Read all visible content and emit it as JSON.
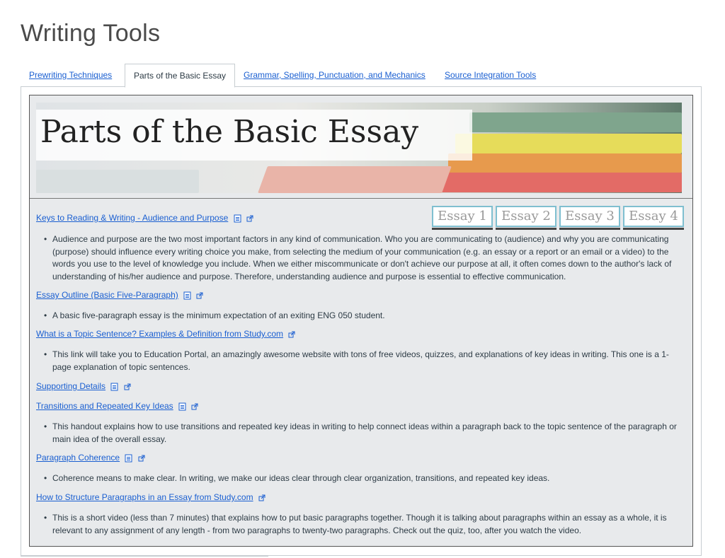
{
  "page": {
    "title": "Writing Tools"
  },
  "tabs": [
    {
      "label": "Prewriting Techniques",
      "active": false
    },
    {
      "label": "Parts of the Basic Essay",
      "active": true
    },
    {
      "label": "Grammar, Spelling, Punctuation, and Mechanics",
      "active": false
    },
    {
      "label": "Source Integration Tools",
      "active": false
    }
  ],
  "banner": {
    "title": "Parts of the Basic Essay"
  },
  "essay_tabs": [
    "Essay 1",
    "Essay 2",
    "Essay 3",
    "Essay 4"
  ],
  "resources": [
    {
      "link": "Keys to Reading & Writing - Audience and Purpose",
      "doc_icon": true,
      "description": "Audience and purpose are the two most important factors in any kind of communication. Who you are communicating to (audience) and why you are communicating (purpose) should influence every writing choice you make, from selecting the medium of your communication (e.g. an essay or a report or an email or a video) to the words you use to the level of knowledge you include. When we either miscommunicate or don't achieve our purpose at all, it often comes down to the author's lack of understanding of his/her audience and purpose. Therefore, understanding audience and purpose is essential to effective communication."
    },
    {
      "link": "Essay Outline (Basic Five-Paragraph)",
      "doc_icon": true,
      "description": "A basic five-paragraph essay is the minimum expectation of an exiting ENG 050 student."
    },
    {
      "link": "What is a Topic Sentence? Examples & Definition from Study.com",
      "doc_icon": false,
      "description": "This link will take you to Education Portal, an amazingly awesome website with tons of free videos, quizzes, and explanations of key ideas in writing. This one is a 1-page explanation of topic sentences."
    },
    {
      "link": "Supporting Details",
      "doc_icon": true,
      "description": ""
    },
    {
      "link": "Transitions and Repeated Key Ideas",
      "doc_icon": true,
      "description": "This handout explains how to use transitions and repeated key ideas in writing to help connect ideas within a paragraph back to the topic sentence of the paragraph or main idea of the overall essay."
    },
    {
      "link": "Paragraph Coherence",
      "doc_icon": true,
      "description": "Coherence means to make clear. In writing, we make our ideas clear through clear organization, transitions, and repeated key ideas."
    },
    {
      "link": "How to Structure Paragraphs in an Essay from Study.com",
      "doc_icon": false,
      "description": "This is a short video (less than 7 minutes) that explains how to put basic paragraphs together. Though it is talking about paragraphs within an essay as a whole, it is relevant to any assignment of any length - from two paragraphs to twenty-two paragraphs. Check out the quiz, too, after you watch the video."
    }
  ],
  "colors": {
    "link": "#1a5fd1",
    "essay_tab_border": "#7fbfd0",
    "content_bg": "#e8eaec"
  }
}
